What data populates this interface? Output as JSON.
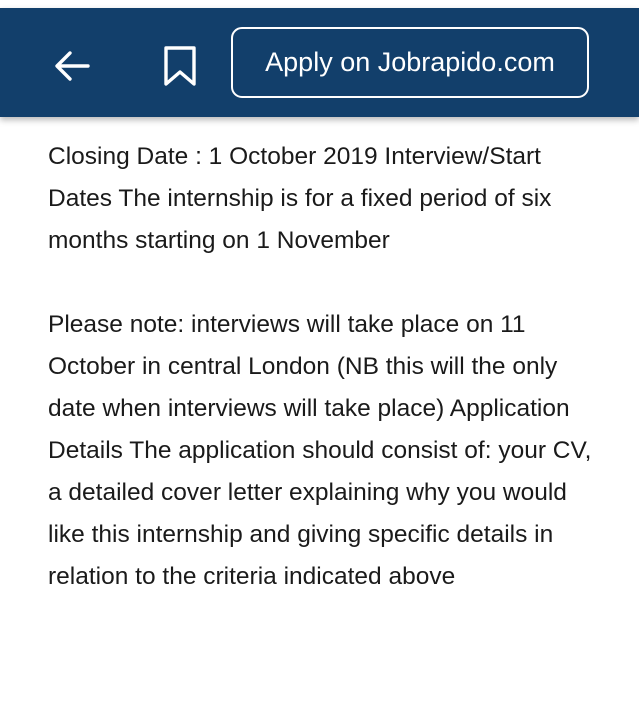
{
  "header": {
    "background_color": "#123f6b",
    "back_icon": "arrow-left-icon",
    "bookmark_icon": "bookmark-icon",
    "apply_label": "Apply on Jobrapido.com"
  },
  "content": {
    "paragraph_1": "Closing Date : 1 October 2019 Interview/Start Dates The internship is for a fixed period of six months starting on 1 November",
    "paragraph_2": "Please note: interviews will take place on 11 October in central London (NB this will the only date when interviews will take place) Application Details The application should consist of: your CV, a detailed cover letter explaining why you would like this internship and giving specific details in relation to the criteria indicated above"
  }
}
